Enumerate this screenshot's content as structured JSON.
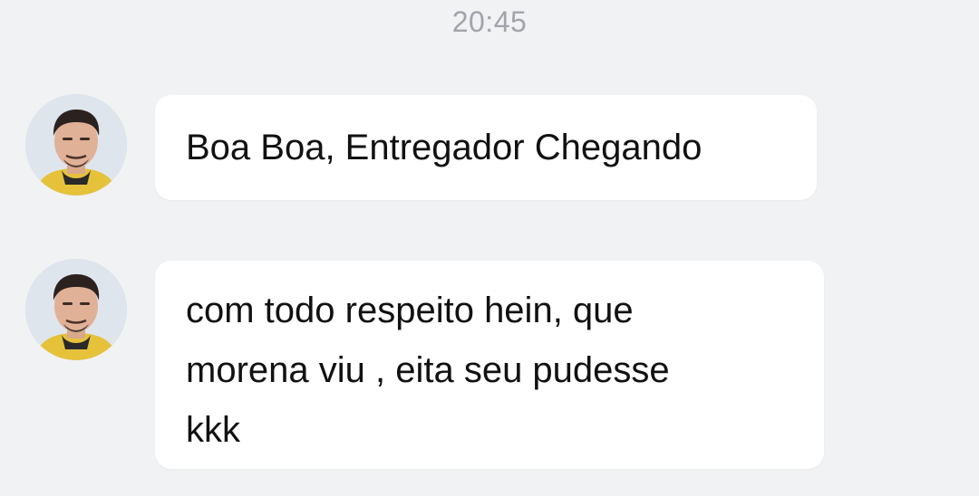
{
  "chat": {
    "timestamp": "20:45",
    "messages": [
      {
        "sender_avatar": "avatar-icon",
        "text": "Boa Boa, Entregador Chegando"
      },
      {
        "sender_avatar": "avatar-icon",
        "text": "com todo respeito hein, que\nmorena viu , eita seu pudesse\nkkk"
      }
    ]
  },
  "colors": {
    "background": "#f1f2f4",
    "bubble": "#ffffff",
    "timestamp": "#a1a4aa",
    "text": "#111111"
  }
}
